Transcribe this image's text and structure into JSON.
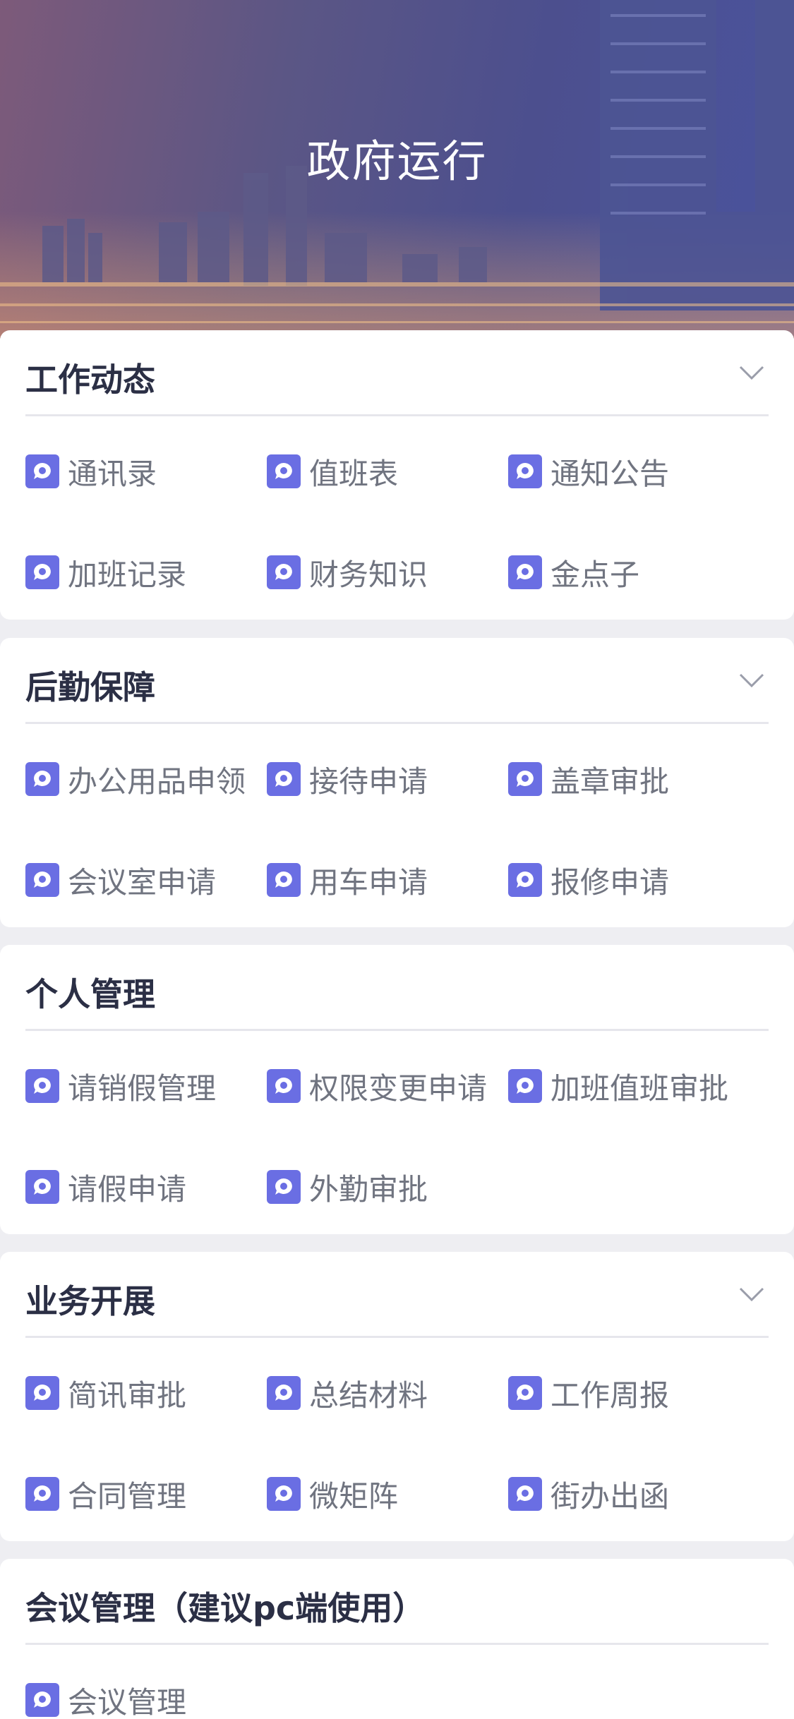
{
  "header": {
    "title": "政府运行"
  },
  "colors": {
    "accent": "#6a6ee3",
    "title_text": "#2b2f45",
    "item_text": "#707480"
  },
  "sections": [
    {
      "title": "工作动态",
      "has_chevron": true,
      "items": [
        {
          "label": "通讯录",
          "icon": "chat-bubble-icon"
        },
        {
          "label": "值班表",
          "icon": "chat-bubble-icon"
        },
        {
          "label": "通知公告",
          "icon": "chat-bubble-icon"
        },
        {
          "label": "加班记录",
          "icon": "chat-bubble-icon"
        },
        {
          "label": "财务知识",
          "icon": "chat-bubble-icon"
        },
        {
          "label": "金点子",
          "icon": "chat-bubble-icon"
        }
      ]
    },
    {
      "title": "后勤保障",
      "has_chevron": true,
      "items": [
        {
          "label": "办公用品申领",
          "icon": "chat-bubble-icon"
        },
        {
          "label": "接待申请",
          "icon": "chat-bubble-icon"
        },
        {
          "label": "盖章审批",
          "icon": "chat-bubble-icon"
        },
        {
          "label": "会议室申请",
          "icon": "chat-bubble-icon"
        },
        {
          "label": "用车申请",
          "icon": "chat-bubble-icon"
        },
        {
          "label": "报修申请",
          "icon": "chat-bubble-icon"
        }
      ]
    },
    {
      "title": "个人管理",
      "has_chevron": false,
      "items": [
        {
          "label": "请销假管理",
          "icon": "chat-bubble-icon"
        },
        {
          "label": "权限变更申请",
          "icon": "chat-bubble-icon"
        },
        {
          "label": "加班值班审批",
          "icon": "chat-bubble-icon"
        },
        {
          "label": "请假申请",
          "icon": "chat-bubble-icon"
        },
        {
          "label": "外勤审批",
          "icon": "chat-bubble-icon"
        }
      ]
    },
    {
      "title": "业务开展",
      "has_chevron": true,
      "items": [
        {
          "label": "简讯审批",
          "icon": "chat-bubble-icon"
        },
        {
          "label": "总结材料",
          "icon": "chat-bubble-icon"
        },
        {
          "label": "工作周报",
          "icon": "chat-bubble-icon"
        },
        {
          "label": "合同管理",
          "icon": "chat-bubble-icon"
        },
        {
          "label": "微矩阵",
          "icon": "chat-bubble-icon"
        },
        {
          "label": "街办出函",
          "icon": "chat-bubble-icon"
        }
      ]
    },
    {
      "title": "会议管理（建议pc端使用）",
      "has_chevron": false,
      "items": [
        {
          "label": "会议管理",
          "icon": "chat-bubble-icon"
        }
      ]
    }
  ]
}
